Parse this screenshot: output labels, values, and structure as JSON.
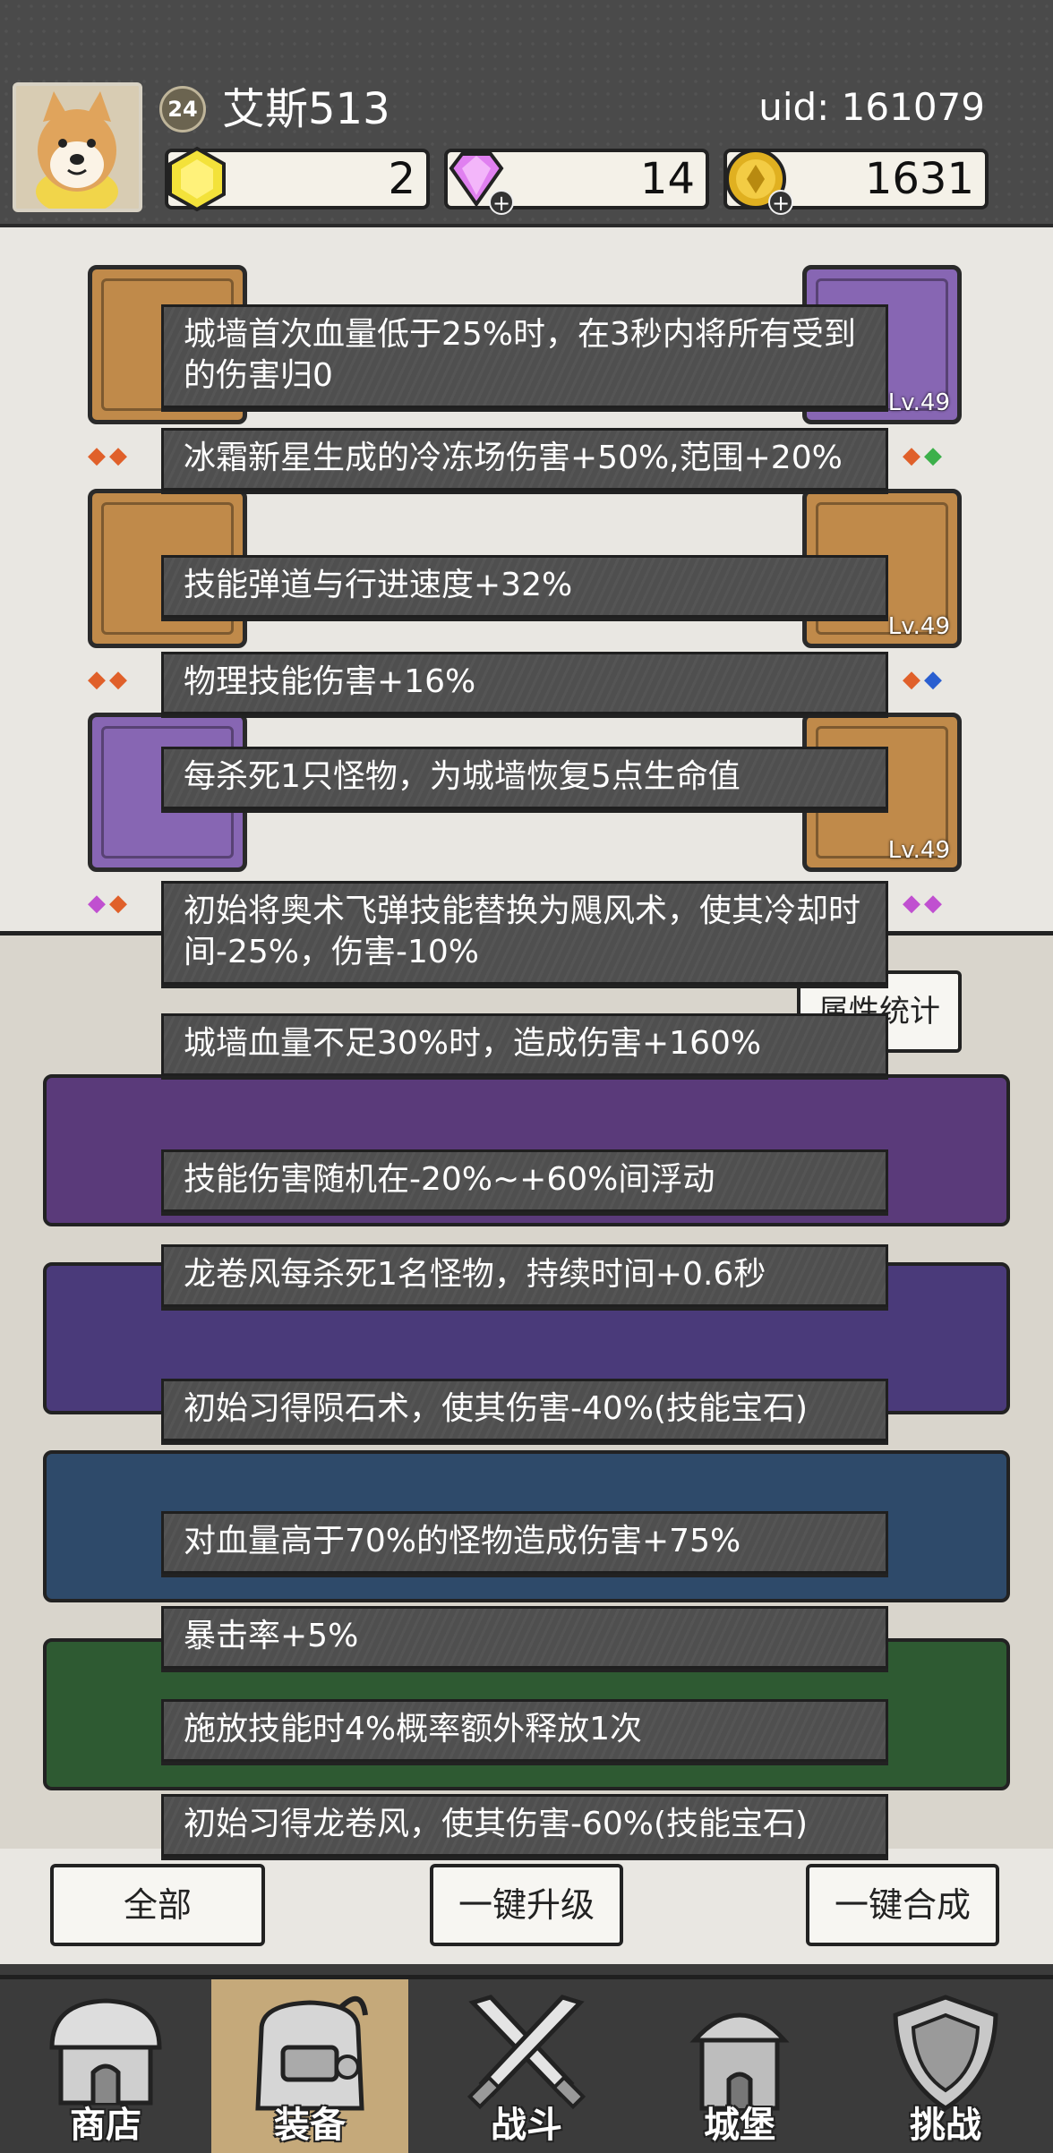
{
  "player": {
    "level": "24",
    "name": "艾斯513",
    "uid": "uid: 161079"
  },
  "currencies": [
    {
      "icon": "gold-hexagon-icon",
      "value": "2",
      "color": "#f3e23a"
    },
    {
      "icon": "pink-diamond-icon",
      "value": "14",
      "color": "#e080f0"
    },
    {
      "icon": "gold-coin-icon",
      "value": "1631",
      "color": "#e0b020"
    }
  ],
  "gear_levels": {
    "right_top": "Lv.49",
    "right_mid": "Lv.49",
    "right_bottom": "Lv.49"
  },
  "panel": {
    "attr_stats_label": "属性统计",
    "bottom_buttons": [
      "全部",
      "一键升级",
      "一键合成"
    ]
  },
  "tooltips": [
    "城墙首次血量低于25%时，在3秒内将所有受到的伤害归0",
    "冰霜新星生成的冷冻场伤害+50%,范围+20%",
    "技能弹道与行进速度+32%",
    "物理技能伤害+16%",
    "每杀死1只怪物，为城墙恢复5点生命值",
    "初始将奥术飞弹技能替换为飓风术，使其冷却时间-25%，伤害-10%",
    "城墙血量不足30%时，造成伤害+160%",
    "技能伤害随机在-20%~+60%间浮动",
    "龙卷风每杀死1名怪物，持续时间+0.6秒",
    "初始习得陨石术，使其伤害-40%(技能宝石)",
    "对血量高于70%的怪物造成伤害+75%",
    "暴击率+5%",
    "施放技能时4%概率额外释放1次",
    "初始习得龙卷风，使其伤害-60%(技能宝石)"
  ],
  "nav": {
    "items": [
      {
        "label": "商店",
        "icon": "shop-house-icon"
      },
      {
        "label": "装备",
        "icon": "backpack-icon"
      },
      {
        "label": "战斗",
        "icon": "crossed-swords-icon"
      },
      {
        "label": "城堡",
        "icon": "castle-icon"
      },
      {
        "label": "挑战",
        "icon": "shield-icon"
      }
    ],
    "active_index": 1
  },
  "colors": {
    "tooltip_bg": "#4f4f4f",
    "header_bg": "#4a4a4a",
    "active_tab": "#c5a97a"
  }
}
